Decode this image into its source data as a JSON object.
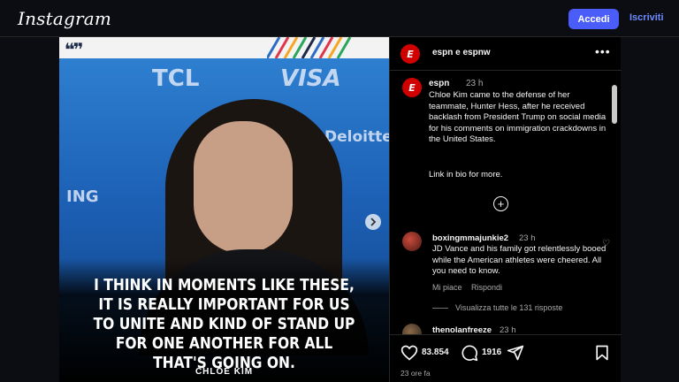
{
  "header": {
    "logo": "Instagram",
    "login_label": "Accedi",
    "signup_label": "Iscriviti"
  },
  "post_image": {
    "quote_mark": "❝❞",
    "sponsors": [
      "TCL",
      "VISA",
      "Deloitte",
      "ING"
    ],
    "quote": "I THINK IN MOMENTS LIKE THESE, IT IS REALLY IMPORTANT FOR US TO UNITE AND KIND OF STAND UP FOR ONE ANOTHER FOR ALL THAT'S GOING ON.",
    "author": "CHLOE KIM",
    "next_icon": "chevron-right-icon"
  },
  "panel": {
    "header_names": "espn e espnw",
    "avatar_letter": "E",
    "caption": {
      "user": "espn",
      "time": "23 h",
      "text": "Chloe Kim came to the defense of her teammate, Hunter Hess, after he received backlash from President Trump on social media for his comments on immigration crackdowns in the United States.",
      "link_text": "Link in bio for more."
    },
    "load_more_icon": "plus-circle-icon",
    "comments": [
      {
        "user": "boxingmmajunkie2",
        "time": "23 h",
        "text": "JD Vance and his family got relentlessly booed while the American athletes were cheered. All you need to know.",
        "like_label": "Mi piace",
        "reply_label": "Rispondi",
        "view_replies": "Visualizza tutte le 131 risposte"
      },
      {
        "user": "thenolanfreeze",
        "time": "23 h",
        "text": ""
      }
    ]
  },
  "actions": {
    "likes": "83.854",
    "comments": "1916",
    "posted": "23 ore fa"
  },
  "colors": {
    "background": "#0b0d13",
    "accent": "#4a5df9",
    "espn_red": "#d00000"
  }
}
